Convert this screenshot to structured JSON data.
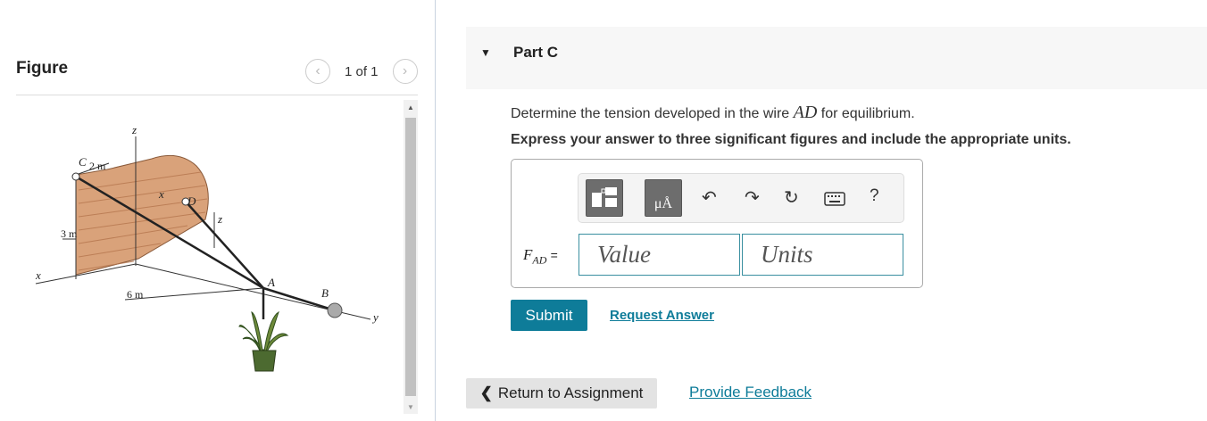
{
  "figure": {
    "title": "Figure",
    "pager": {
      "text": "1 of 1"
    },
    "labels": {
      "z_top": "z",
      "c": "C",
      "two_m": "2 m",
      "x_small": "x",
      "d": "D",
      "z_small": "z",
      "three_m": "3 m",
      "x_axis": "x",
      "six_m": "6 m",
      "a": "A",
      "b": "B",
      "y_axis": "y"
    }
  },
  "part": {
    "title": "Part C"
  },
  "question": {
    "prefix": "Determine the tension developed in the wire",
    "symbol": "AD",
    "suffix": "for equilibrium."
  },
  "instruction": "Express your answer to three significant figures and include the appropriate units.",
  "answer": {
    "var_main": "F",
    "var_sub": "AD",
    "equals": "=",
    "value_placeholder": "Value",
    "units_placeholder": "Units"
  },
  "toolbar": {
    "units_label": "μÅ",
    "help_label": "?",
    "icons": [
      "templates-icon",
      "units-icon",
      "undo-icon",
      "redo-icon",
      "reset-icon",
      "keyboard-icon",
      "help-icon"
    ]
  },
  "buttons": {
    "submit": "Submit",
    "request": "Request Answer",
    "return": "Return to Assignment",
    "feedback": "Provide Feedback"
  },
  "colors": {
    "accent": "#0e7c99",
    "wall": "#d9a27a"
  }
}
